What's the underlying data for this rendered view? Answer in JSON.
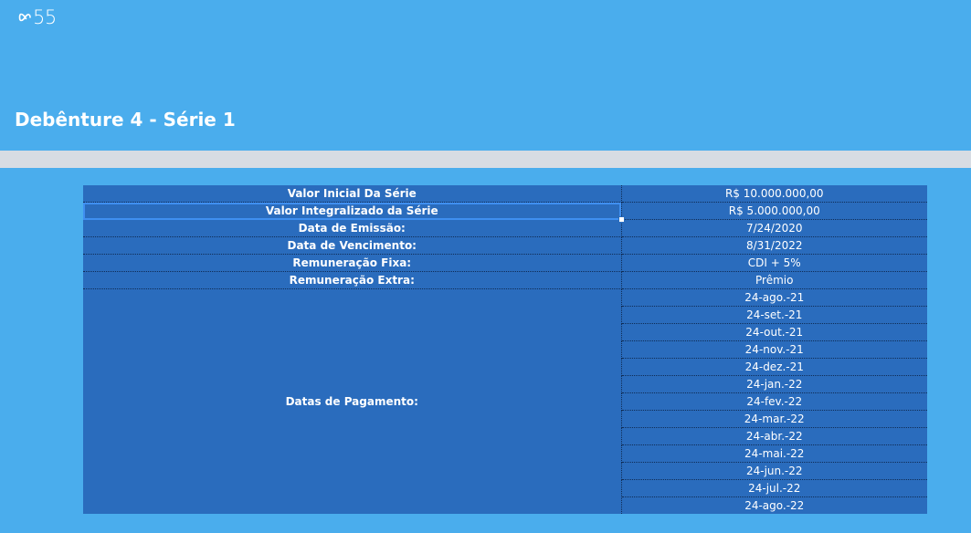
{
  "header": {
    "logo_text": "55",
    "title": "Debênture 4 - Série 1"
  },
  "colors": {
    "background": "#4aaded",
    "band": "#d7dce3",
    "table": "#2a6cbd",
    "text": "#ffffff"
  },
  "icons": {
    "logo": "infinity-loop-icon"
  },
  "table": {
    "rows": [
      {
        "label": "Valor Inicial Da Série",
        "value": "R$ 10.000.000,00"
      },
      {
        "label": "Valor Integralizado da Série",
        "value": "R$ 5.000.000,00"
      },
      {
        "label": "Data de Emissão:",
        "value": "7/24/2020"
      },
      {
        "label": "Data de Vencimento:",
        "value": "8/31/2022"
      },
      {
        "label": "Remuneração Fixa:",
        "value": "CDI + 5%"
      },
      {
        "label": "Remuneração Extra:",
        "value": "Prêmio"
      }
    ],
    "payment_label": "Datas de Pagamento:",
    "payment_dates": [
      "24-ago.-21",
      "24-set.-21",
      "24-out.-21",
      "24-nov.-21",
      "24-dez.-21",
      "24-jan.-22",
      "24-fev.-22",
      "24-mar.-22",
      "24-abr.-22",
      "24-mai.-22",
      "24-jun.-22",
      "24-jul.-22",
      "24-ago.-22"
    ]
  }
}
